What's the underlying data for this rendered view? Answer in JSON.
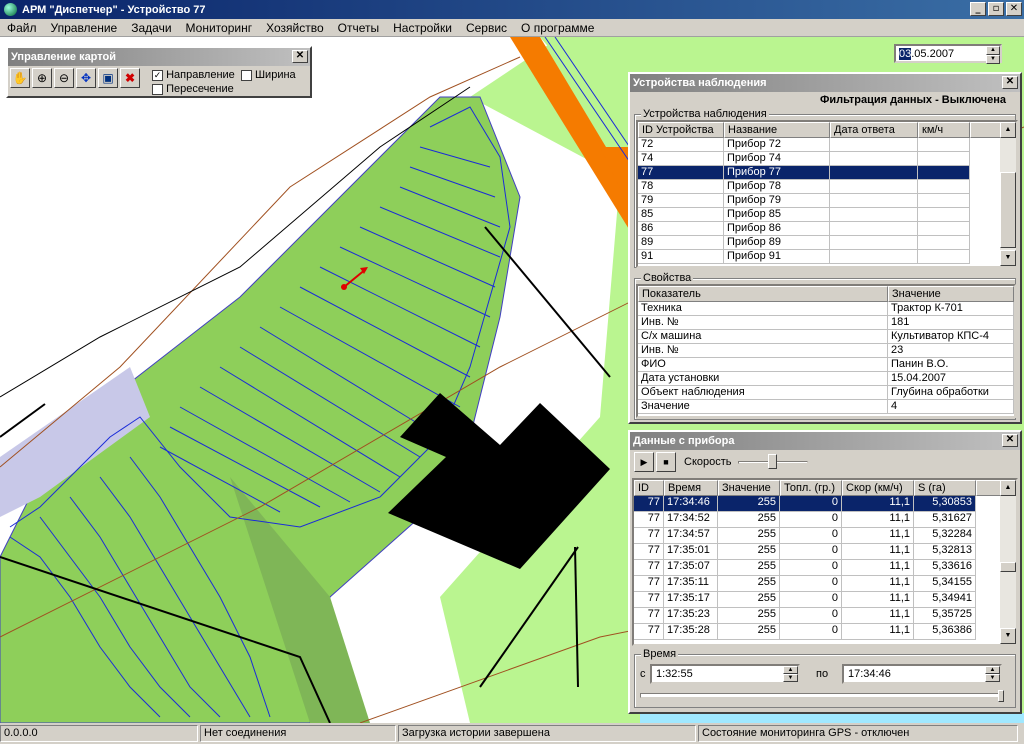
{
  "window": {
    "title": "АРМ \"Диспетчер\"  - Устройство 77",
    "minimize": "_",
    "maximize": "▫",
    "close": "✕"
  },
  "menu": [
    "Файл",
    "Управление",
    "Задачи",
    "Мониторинг",
    "Хозяйство",
    "Отчеты",
    "Настройки",
    "Сервис",
    "О программе"
  ],
  "date": {
    "day": "03",
    "rest": ".05.2007"
  },
  "map_control": {
    "title": "Управление картой",
    "direction_label": "Направление",
    "direction_checked": "✓",
    "width_label": "Ширина",
    "intersection_label": "Пересечение"
  },
  "devices": {
    "title": "Устройства наблюдения",
    "filter": "Фильтрация данных - Выключена",
    "group_label": "Устройства наблюдения",
    "columns": [
      "ID Устройства",
      "Название",
      "Дата ответа",
      "км/ч"
    ],
    "rows": [
      {
        "id": "72",
        "name": "Прибор 72"
      },
      {
        "id": "74",
        "name": "Прибор 74"
      },
      {
        "id": "77",
        "name": "Прибор 77"
      },
      {
        "id": "78",
        "name": "Прибор 78"
      },
      {
        "id": "79",
        "name": "Прибор 79"
      },
      {
        "id": "85",
        "name": "Прибор 85"
      },
      {
        "id": "86",
        "name": "Прибор 86"
      },
      {
        "id": "89",
        "name": "Прибор 89"
      },
      {
        "id": "91",
        "name": "Прибор 91"
      }
    ],
    "props_label": "Свойства",
    "props_columns": [
      "Показатель",
      "Значение"
    ],
    "props": [
      {
        "k": "Техника",
        "v": "Трактор К-701"
      },
      {
        "k": "Инв. №",
        "v": "181"
      },
      {
        "k": "С/х машина",
        "v": "Культиватор КПС-4"
      },
      {
        "k": "Инв. №",
        "v": "23"
      },
      {
        "k": "ФИО",
        "v": "Панин В.О."
      },
      {
        "k": "Дата установки",
        "v": "15.04.2007"
      },
      {
        "k": "Объект наблюдения",
        "v": "Глубина обработки"
      },
      {
        "k": "Значение",
        "v": "4"
      }
    ]
  },
  "device_data": {
    "title": "Данные с прибора",
    "speed_label": "Скорость",
    "speed_level": 0.5,
    "columns": [
      "ID",
      "Время",
      "Значение",
      "Топл. (гр.)",
      "Скор (км/ч)",
      "S (га)"
    ],
    "rows": [
      {
        "id": "77",
        "t": "17:34:46",
        "v": "255",
        "f": "0",
        "s": "11,1",
        "a": "5,30853"
      },
      {
        "id": "77",
        "t": "17:34:52",
        "v": "255",
        "f": "0",
        "s": "11,1",
        "a": "5,31627"
      },
      {
        "id": "77",
        "t": "17:34:57",
        "v": "255",
        "f": "0",
        "s": "11,1",
        "a": "5,32284"
      },
      {
        "id": "77",
        "t": "17:35:01",
        "v": "255",
        "f": "0",
        "s": "11,1",
        "a": "5,32813"
      },
      {
        "id": "77",
        "t": "17:35:07",
        "v": "255",
        "f": "0",
        "s": "11,1",
        "a": "5,33616"
      },
      {
        "id": "77",
        "t": "17:35:11",
        "v": "255",
        "f": "0",
        "s": "11,1",
        "a": "5,34155"
      },
      {
        "id": "77",
        "t": "17:35:17",
        "v": "255",
        "f": "0",
        "s": "11,1",
        "a": "5,34941"
      },
      {
        "id": "77",
        "t": "17:35:23",
        "v": "255",
        "f": "0",
        "s": "11,1",
        "a": "5,35725"
      },
      {
        "id": "77",
        "t": "17:35:28",
        "v": "255",
        "f": "0",
        "s": "11,1",
        "a": "5,36386"
      }
    ],
    "time_label": "Время",
    "from_label": "с",
    "from_value": "1:32:55",
    "to_label": "по",
    "to_value": "17:34:46"
  },
  "status": [
    "0.0.0.0",
    "Нет соединения",
    "Загрузка истории завершена",
    "Состояние мониторинга GPS - отключен"
  ]
}
